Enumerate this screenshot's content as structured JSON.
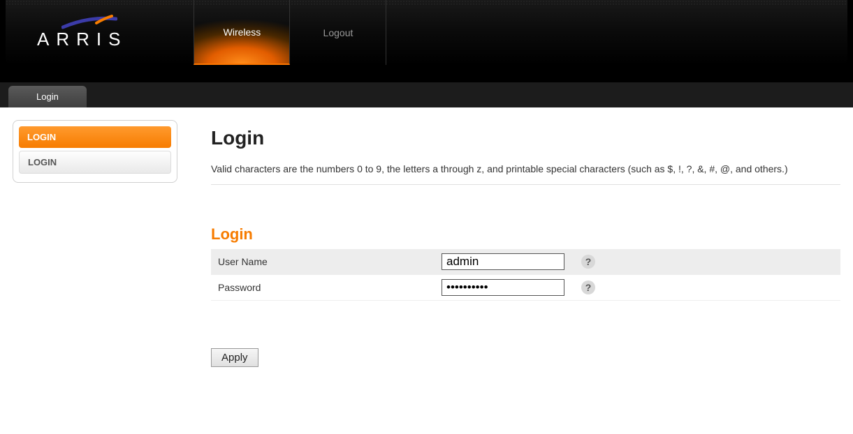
{
  "brand": "ARRIS",
  "nav": {
    "tabs": [
      {
        "label": "Wireless",
        "active": true
      },
      {
        "label": "Logout",
        "active": false
      }
    ]
  },
  "subnav": {
    "tab": "Login"
  },
  "sidebar": {
    "items": [
      {
        "label": "LOGIN",
        "active": true
      },
      {
        "label": "LOGIN",
        "active": false
      }
    ]
  },
  "page": {
    "title": "Login",
    "description": "Valid characters are the numbers 0 to 9, the letters a through z, and printable special characters (such as $, !, ?, &, #, @, and others.)"
  },
  "form": {
    "section_title": "Login",
    "fields": {
      "username": {
        "label": "User Name",
        "value": "admin"
      },
      "password": {
        "label": "Password",
        "value": "••••••••••"
      }
    },
    "apply_label": "Apply"
  }
}
